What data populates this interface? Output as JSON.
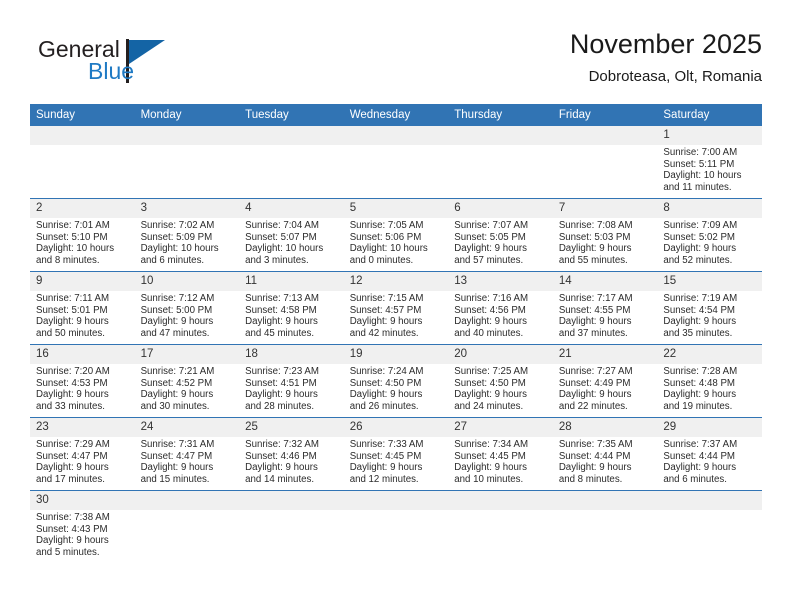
{
  "brand": {
    "name_top": "General",
    "name_bottom": "Blue",
    "logo_icon": "triangle-flag-icon",
    "accent_color": "#1464a5",
    "text_color": "#231f20"
  },
  "header": {
    "title": "November 2025",
    "subtitle": "Dobroteasa, Olt, Romania"
  },
  "theme": {
    "header_row_color": "#3174b4",
    "daynum_band_color": "#f0f0f0",
    "row_divider_color": "#3174b4"
  },
  "weekday_headers": [
    "Sunday",
    "Monday",
    "Tuesday",
    "Wednesday",
    "Thursday",
    "Friday",
    "Saturday"
  ],
  "labels": {
    "sunrise": "Sunrise:",
    "sunset": "Sunset:",
    "daylight": "Daylight:"
  },
  "weeks": [
    [
      {
        "day": "",
        "lines": []
      },
      {
        "day": "",
        "lines": []
      },
      {
        "day": "",
        "lines": []
      },
      {
        "day": "",
        "lines": []
      },
      {
        "day": "",
        "lines": []
      },
      {
        "day": "",
        "lines": []
      },
      {
        "day": "1",
        "lines": [
          "Sunrise: 7:00 AM",
          "Sunset: 5:11 PM",
          "Daylight: 10 hours",
          "and 11 minutes."
        ]
      }
    ],
    [
      {
        "day": "2",
        "lines": [
          "Sunrise: 7:01 AM",
          "Sunset: 5:10 PM",
          "Daylight: 10 hours",
          "and 8 minutes."
        ]
      },
      {
        "day": "3",
        "lines": [
          "Sunrise: 7:02 AM",
          "Sunset: 5:09 PM",
          "Daylight: 10 hours",
          "and 6 minutes."
        ]
      },
      {
        "day": "4",
        "lines": [
          "Sunrise: 7:04 AM",
          "Sunset: 5:07 PM",
          "Daylight: 10 hours",
          "and 3 minutes."
        ]
      },
      {
        "day": "5",
        "lines": [
          "Sunrise: 7:05 AM",
          "Sunset: 5:06 PM",
          "Daylight: 10 hours",
          "and 0 minutes."
        ]
      },
      {
        "day": "6",
        "lines": [
          "Sunrise: 7:07 AM",
          "Sunset: 5:05 PM",
          "Daylight: 9 hours",
          "and 57 minutes."
        ]
      },
      {
        "day": "7",
        "lines": [
          "Sunrise: 7:08 AM",
          "Sunset: 5:03 PM",
          "Daylight: 9 hours",
          "and 55 minutes."
        ]
      },
      {
        "day": "8",
        "lines": [
          "Sunrise: 7:09 AM",
          "Sunset: 5:02 PM",
          "Daylight: 9 hours",
          "and 52 minutes."
        ]
      }
    ],
    [
      {
        "day": "9",
        "lines": [
          "Sunrise: 7:11 AM",
          "Sunset: 5:01 PM",
          "Daylight: 9 hours",
          "and 50 minutes."
        ]
      },
      {
        "day": "10",
        "lines": [
          "Sunrise: 7:12 AM",
          "Sunset: 5:00 PM",
          "Daylight: 9 hours",
          "and 47 minutes."
        ]
      },
      {
        "day": "11",
        "lines": [
          "Sunrise: 7:13 AM",
          "Sunset: 4:58 PM",
          "Daylight: 9 hours",
          "and 45 minutes."
        ]
      },
      {
        "day": "12",
        "lines": [
          "Sunrise: 7:15 AM",
          "Sunset: 4:57 PM",
          "Daylight: 9 hours",
          "and 42 minutes."
        ]
      },
      {
        "day": "13",
        "lines": [
          "Sunrise: 7:16 AM",
          "Sunset: 4:56 PM",
          "Daylight: 9 hours",
          "and 40 minutes."
        ]
      },
      {
        "day": "14",
        "lines": [
          "Sunrise: 7:17 AM",
          "Sunset: 4:55 PM",
          "Daylight: 9 hours",
          "and 37 minutes."
        ]
      },
      {
        "day": "15",
        "lines": [
          "Sunrise: 7:19 AM",
          "Sunset: 4:54 PM",
          "Daylight: 9 hours",
          "and 35 minutes."
        ]
      }
    ],
    [
      {
        "day": "16",
        "lines": [
          "Sunrise: 7:20 AM",
          "Sunset: 4:53 PM",
          "Daylight: 9 hours",
          "and 33 minutes."
        ]
      },
      {
        "day": "17",
        "lines": [
          "Sunrise: 7:21 AM",
          "Sunset: 4:52 PM",
          "Daylight: 9 hours",
          "and 30 minutes."
        ]
      },
      {
        "day": "18",
        "lines": [
          "Sunrise: 7:23 AM",
          "Sunset: 4:51 PM",
          "Daylight: 9 hours",
          "and 28 minutes."
        ]
      },
      {
        "day": "19",
        "lines": [
          "Sunrise: 7:24 AM",
          "Sunset: 4:50 PM",
          "Daylight: 9 hours",
          "and 26 minutes."
        ]
      },
      {
        "day": "20",
        "lines": [
          "Sunrise: 7:25 AM",
          "Sunset: 4:50 PM",
          "Daylight: 9 hours",
          "and 24 minutes."
        ]
      },
      {
        "day": "21",
        "lines": [
          "Sunrise: 7:27 AM",
          "Sunset: 4:49 PM",
          "Daylight: 9 hours",
          "and 22 minutes."
        ]
      },
      {
        "day": "22",
        "lines": [
          "Sunrise: 7:28 AM",
          "Sunset: 4:48 PM",
          "Daylight: 9 hours",
          "and 19 minutes."
        ]
      }
    ],
    [
      {
        "day": "23",
        "lines": [
          "Sunrise: 7:29 AM",
          "Sunset: 4:47 PM",
          "Daylight: 9 hours",
          "and 17 minutes."
        ]
      },
      {
        "day": "24",
        "lines": [
          "Sunrise: 7:31 AM",
          "Sunset: 4:47 PM",
          "Daylight: 9 hours",
          "and 15 minutes."
        ]
      },
      {
        "day": "25",
        "lines": [
          "Sunrise: 7:32 AM",
          "Sunset: 4:46 PM",
          "Daylight: 9 hours",
          "and 14 minutes."
        ]
      },
      {
        "day": "26",
        "lines": [
          "Sunrise: 7:33 AM",
          "Sunset: 4:45 PM",
          "Daylight: 9 hours",
          "and 12 minutes."
        ]
      },
      {
        "day": "27",
        "lines": [
          "Sunrise: 7:34 AM",
          "Sunset: 4:45 PM",
          "Daylight: 9 hours",
          "and 10 minutes."
        ]
      },
      {
        "day": "28",
        "lines": [
          "Sunrise: 7:35 AM",
          "Sunset: 4:44 PM",
          "Daylight: 9 hours",
          "and 8 minutes."
        ]
      },
      {
        "day": "29",
        "lines": [
          "Sunrise: 7:37 AM",
          "Sunset: 4:44 PM",
          "Daylight: 9 hours",
          "and 6 minutes."
        ]
      }
    ],
    [
      {
        "day": "30",
        "lines": [
          "Sunrise: 7:38 AM",
          "Sunset: 4:43 PM",
          "Daylight: 9 hours",
          "and 5 minutes."
        ]
      },
      {
        "day": "",
        "lines": []
      },
      {
        "day": "",
        "lines": []
      },
      {
        "day": "",
        "lines": []
      },
      {
        "day": "",
        "lines": []
      },
      {
        "day": "",
        "lines": []
      },
      {
        "day": "",
        "lines": []
      }
    ]
  ]
}
